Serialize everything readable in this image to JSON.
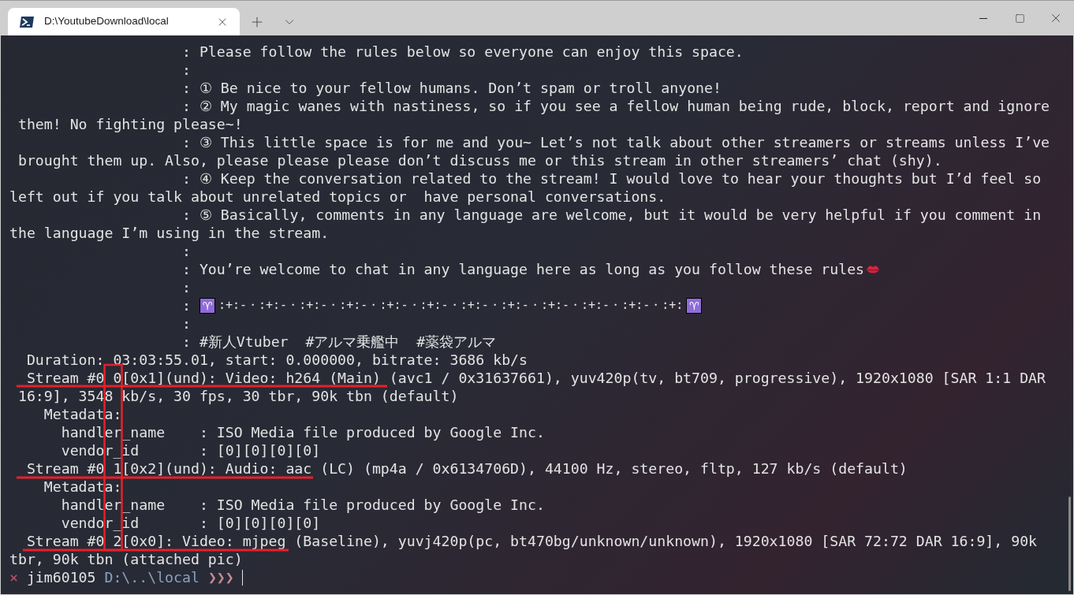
{
  "window": {
    "tab": {
      "title": "D:\\YoutubeDownload\\local",
      "selected": true
    }
  },
  "terminal": {
    "lines": [
      {
        "kind": "plain",
        "text": "                    : Please follow the rules below so everyone can enjoy this space."
      },
      {
        "kind": "plain",
        "text": "                    :"
      },
      {
        "kind": "plain",
        "text": "                    : ① Be nice to your fellow humans. Don’t spam or troll anyone!"
      },
      {
        "kind": "plain",
        "text": "                    : ② My magic wanes with nastiness, so if you see a fellow human being rude, block, report and ignore"
      },
      {
        "kind": "plain",
        "text": " them! No fighting please~!"
      },
      {
        "kind": "plain",
        "text": "                    : ③ This little space is for me and you~ Let’s not talk about other streamers or streams unless I’ve"
      },
      {
        "kind": "plain",
        "text": " brought them up. Also, please please please don’t discuss me or this stream in other streamers’ chat (shy)."
      },
      {
        "kind": "plain",
        "text": "                    : ④ Keep the conversation related to the stream! I would love to hear your thoughts but I’d feel so"
      },
      {
        "kind": "plain",
        "text": "left out if you talk about unrelated topics or  have personal conversations."
      },
      {
        "kind": "plain",
        "text": "                    : ⑤ Basically, comments in any language are welcome, but it would be very helpful if you comment in"
      },
      {
        "kind": "plain",
        "text": "the language I’m using in the stream."
      },
      {
        "kind": "plain",
        "text": "                    :"
      },
      {
        "kind": "lips",
        "text": "                    : You’re welcome to chat in any language here as long as you follow these rules"
      },
      {
        "kind": "plain",
        "text": "                    :"
      },
      {
        "kind": "ornament",
        "text": "                    : ",
        "symbol": "♈",
        "pattern": ":+:-・:+:-・:+:-・:+:-・:+:-・:+:-・:+:-・:+:-・:+:-・:+:-・:+:-・:+:"
      },
      {
        "kind": "plain",
        "text": "                    :"
      },
      {
        "kind": "plain",
        "text": "                    : #新人Vtuber  #アルマ乗艦中  #薬袋アルマ"
      },
      {
        "kind": "plain",
        "text": "  Duration: 03:03:55.01, start: 0.000000, bitrate: 3686 kb/s"
      },
      {
        "kind": "plain",
        "text": "  Stream #0 0[0x1](und): Video: h264 (Main) (avc1 / 0x31637661), yuv420p(tv, bt709, progressive), 1920x1080 [SAR 1:1 DAR"
      },
      {
        "kind": "plain",
        "text": " 16:9], 3548 kb/s, 30 fps, 30 tbr, 90k tbn (default)"
      },
      {
        "kind": "plain",
        "text": "    Metadata:"
      },
      {
        "kind": "plain",
        "text": "      handler_name    : ISO Media file produced by Google Inc."
      },
      {
        "kind": "plain",
        "text": "      vendor_id       : [0][0][0][0]"
      },
      {
        "kind": "plain",
        "text": "  Stream #0 1[0x2](und): Audio: aac (LC) (mp4a / 0x6134706D), 44100 Hz, stereo, fltp, 127 kb/s (default)"
      },
      {
        "kind": "plain",
        "text": "    Metadata:"
      },
      {
        "kind": "plain",
        "text": "      handler_name    : ISO Media file produced by Google Inc."
      },
      {
        "kind": "plain",
        "text": "      vendor_id       : [0][0][0][0]"
      },
      {
        "kind": "plain",
        "text": "  Stream #0 2[0x0]: Video: mjpeg (Baseline), yuvj420p(pc, bt470bg/unknown/unknown), 1920x1080 [SAR 72:72 DAR 16:9], 90k"
      },
      {
        "kind": "plain",
        "text": "tbr, 90k tbn (attached pic)"
      }
    ],
    "prompt": {
      "status": "×",
      "user": "jim60105",
      "path": "D:\\..\\local",
      "arrows": "❯❯❯"
    }
  }
}
